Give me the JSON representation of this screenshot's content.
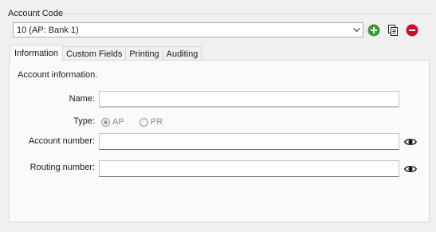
{
  "group": {
    "label": "Account Code"
  },
  "account_select": {
    "value": "10 (AP: Bank 1)"
  },
  "toolbar": {
    "add_icon": "add-circle-icon",
    "copy_icon": "copy-document-icon",
    "delete_icon": "remove-circle-icon",
    "add_color": "#3a9a3a",
    "delete_color": "#c8102e"
  },
  "tabs": [
    {
      "label": "Information",
      "active": true
    },
    {
      "label": "Custom Fields",
      "active": false
    },
    {
      "label": "Printing",
      "active": false
    },
    {
      "label": "Auditing",
      "active": false
    }
  ],
  "info": {
    "heading": "Account information.",
    "name_label": "Name:",
    "name_value": "",
    "type_label": "Type:",
    "type_options": [
      {
        "label": "AP",
        "selected": true
      },
      {
        "label": "PR",
        "selected": false
      }
    ],
    "account_number_label": "Account number:",
    "account_number_value": "",
    "routing_number_label": "Routing number:",
    "routing_number_value": "",
    "reveal_icon": "eye-icon"
  },
  "colors": {
    "focus_accent": "#0067c0"
  }
}
